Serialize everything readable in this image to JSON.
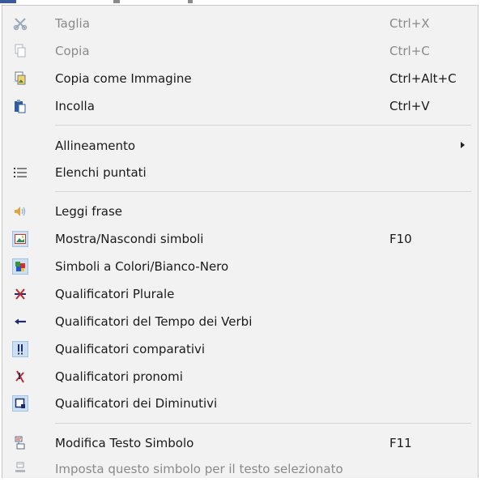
{
  "menu": {
    "items": [
      {
        "label": "Taglia",
        "shortcut": "Ctrl+X",
        "icon": "scissors-icon"
      },
      {
        "label": "Copia",
        "shortcut": "Ctrl+C",
        "icon": "copy-icon"
      },
      {
        "label": "Copia come Immagine",
        "shortcut": "Ctrl+Alt+C",
        "icon": "copy-image-icon"
      },
      {
        "label": "Incolla",
        "shortcut": "Ctrl+V",
        "icon": "paste-icon"
      },
      {
        "label": "Allineamento",
        "shortcut": "",
        "icon": "submenu-arrow-icon"
      },
      {
        "label": "Elenchi puntati",
        "shortcut": "",
        "icon": "bullet-list-icon"
      },
      {
        "label": "Leggi frase",
        "shortcut": "",
        "icon": "speaker-icon"
      },
      {
        "label": "Mostra/Nascondi simboli",
        "shortcut": "F10",
        "icon": "picture-icon"
      },
      {
        "label": "Simboli a Colori/Bianco-Nero",
        "shortcut": "",
        "icon": "color-blocks-icon"
      },
      {
        "label": "Qualificatori Plurale",
        "shortcut": "",
        "icon": "plural-qualifier-icon"
      },
      {
        "label": "Qualificatori del Tempo dei Verbi",
        "shortcut": "",
        "icon": "tense-arrow-icon"
      },
      {
        "label": "Qualificatori comparativi",
        "shortcut": "",
        "icon": "exclamation-icon"
      },
      {
        "label": "Qualificatori pronomi",
        "shortcut": "",
        "icon": "pronoun-qualifier-icon"
      },
      {
        "label": "Qualificatori dei Diminutivi",
        "shortcut": "",
        "icon": "diminutive-icon"
      },
      {
        "label": "Modifica Testo Simbolo",
        "shortcut": "F11",
        "icon": "edit-symbol-text-icon"
      },
      {
        "label": "Imposta questo simbolo per il testo selezionato",
        "shortcut": "",
        "icon": "set-symbol-icon"
      }
    ]
  }
}
